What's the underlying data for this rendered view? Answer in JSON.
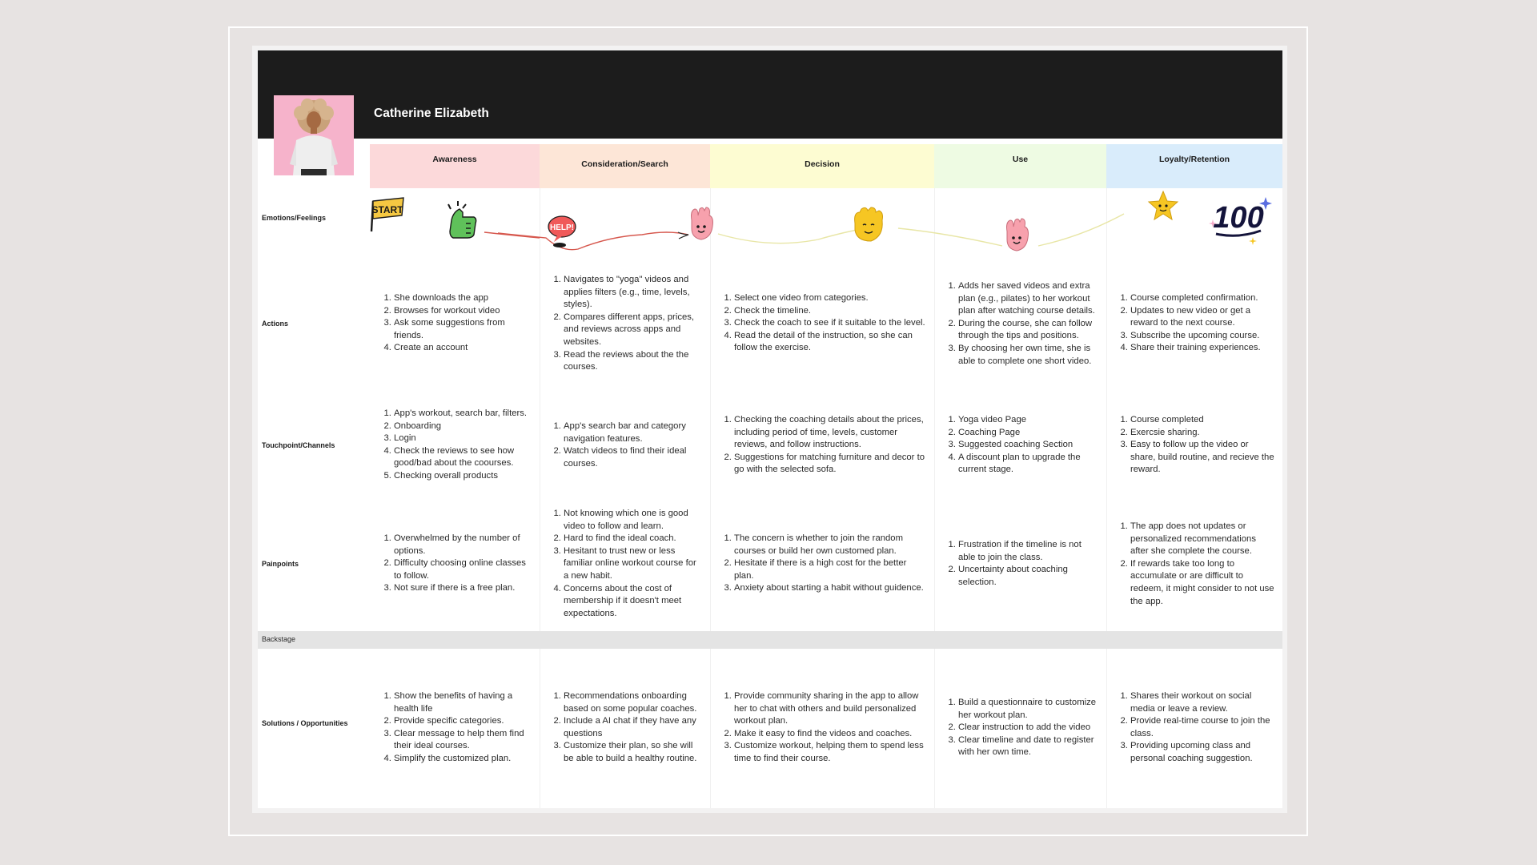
{
  "persona": {
    "name": "Catherine Elizabeth"
  },
  "phases": [
    {
      "label": "Awareness",
      "color": "#fcd9da"
    },
    {
      "label": "Consideration/Search",
      "color": "#fde6d7"
    },
    {
      "label": "Decision",
      "color": "#fdfcd2"
    },
    {
      "label": "Use",
      "color": "#eefbe3"
    },
    {
      "label": "Loyalty/Retention",
      "color": "#d9ecfb"
    }
  ],
  "rows": {
    "emotions": "Emotions/Feelings",
    "actions": "Actions",
    "touchpoints": "Touchpoint/Channels",
    "painpoints": "Painpoints",
    "backstage": "Backstage",
    "solutions": "Solutions / Opportunities"
  },
  "stickers": {
    "start": "START",
    "help": "HELP!",
    "hundred": "100"
  },
  "cells": {
    "actions": [
      [
        "She downloads the app",
        "Browses for workout video",
        "Ask some suggestions from friends.",
        "Create an account"
      ],
      [
        "Navigates to \"yoga\" videos and applies filters (e.g., time, levels, styles).",
        "Compares different apps, prices, and reviews across apps and websites.",
        "Read the reviews about the the courses."
      ],
      [
        "Select one video from categories.",
        "Check the timeline.",
        "Check the coach to see if it suitable to the level.",
        "Read the detail of the instruction, so she can follow the exercise."
      ],
      [
        "Adds her saved videos and extra plan (e.g., pilates) to her workout plan after watching course details.",
        "During the course,  she can follow through the tips and positions.",
        "By choosing her own time, she is able to complete one short video."
      ],
      [
        "Course completed confirmation.",
        "Updates to new video or get a reward to the next course.",
        "Subscribe the upcoming course.",
        "Share their training experiences."
      ]
    ],
    "touchpoints": [
      [
        "App's workout, search bar, filters.",
        "Onboarding",
        "Login",
        "Check the reviews to see how good/bad about the coourses.",
        "Checking overall products"
      ],
      [
        "App's search bar and category navigation features.",
        "Watch videos to find their ideal courses."
      ],
      [
        "Checking the coaching details about the prices, including period of time, levels, customer reviews, and follow instructions.",
        "Suggestions for matching furniture and decor to go with the selected sofa."
      ],
      [
        "Yoga video Page",
        "Coaching Page",
        "Suggested coaching Section",
        " A discount plan to upgrade the current stage."
      ],
      [
        " Course completed",
        "Exercsie sharing.",
        "Easy to follow up the video or share, build routine, and recieve the reward."
      ]
    ],
    "painpoints": [
      [
        "Overwhelmed by the number of options.",
        "Difficulty choosing online classes to follow.",
        "Not sure if there is a free plan."
      ],
      [
        "Not knowing which one is good video to follow and learn.",
        "Hard to find the ideal coach.",
        "Hesitant to trust new or less familiar online workout course for a new habit.",
        "Concerns about the cost of membership if it doesn't meet expectations."
      ],
      [
        "The concern is whether to join the random courses or  build her own customed plan.",
        "Hesitate if there is a high cost for the better plan.",
        "Anxiety about starting a habit without guidence."
      ],
      [
        "Frustration if the timeline is not able to join the class.",
        "Uncertainty about coaching selection."
      ],
      [
        "The app does not updates or personalized recommendations after she complete the course.",
        "If rewards take too long to accumulate or are difficult to redeem, it might consider to not use the app."
      ]
    ],
    "solutions": [
      [
        "Show the benefits of having a health life",
        "Provide specific categories.",
        "Clear message to help them find their ideal courses.",
        "Simplify the customized plan."
      ],
      [
        "Recommendations onboarding based on some popular coaches.",
        "Include a AI chat if they have any questions",
        "Customize their plan, so she will be able to build a healthy routine."
      ],
      [
        "Provide community sharing in the app to allow her to chat with others and build personalized workout plan.",
        "Make it easy to find the videos and coaches.",
        "Customize workout, helping them to spend less time to find their course."
      ],
      [
        "Build a questionnaire to customize her workout plan.",
        "Clear instruction to add the video",
        "Clear timeline and date to register with her own time."
      ],
      [
        "Shares their workout on social media or leave a review.",
        "Provide real-time course to join the class.",
        "Providing upcoming class and personal coaching suggestion."
      ]
    ]
  }
}
